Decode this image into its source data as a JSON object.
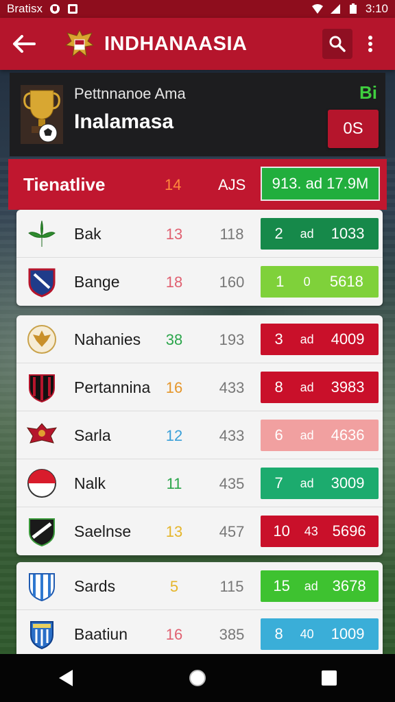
{
  "status_bar": {
    "carrier": "Bratisx",
    "time": "3:10"
  },
  "app_bar": {
    "title": "INDHANAASIA"
  },
  "header": {
    "subtitle": "Pettnnanoe Ama",
    "title": "Inalamasa",
    "badge": "Bi",
    "button_label": "0S"
  },
  "table": {
    "header": {
      "name": "Tienatlive",
      "played": "14",
      "goals": "AJS",
      "points": "913. ad 17.9M"
    },
    "rows": [
      {
        "name": "Bak",
        "played": "13",
        "played_color": "#e06070",
        "goals": "118",
        "pts": [
          "2",
          "ad",
          "1033"
        ],
        "color": "#16894a",
        "crest": "leaf-crest-icon"
      },
      {
        "name": "Bange",
        "played": "18",
        "played_color": "#e06070",
        "goals": "160",
        "pts": [
          "1",
          "0",
          "5618"
        ],
        "color": "#7fd13a",
        "crest": "shield-crest-icon"
      },
      {
        "name": "Nahanies",
        "played": "38",
        "played_color": "#2aa54a",
        "goals": "193",
        "pts": [
          "3",
          "ad",
          "4009"
        ],
        "color": "#c9102a",
        "crest": "garuda-crest-icon"
      },
      {
        "name": "Pertannina",
        "played": "16",
        "played_color": "#e5962a",
        "goals": "433",
        "pts": [
          "8",
          "ad",
          "3983"
        ],
        "color": "#c9102a",
        "crest": "striped-shield-icon"
      },
      {
        "name": "Sarla",
        "played": "12",
        "played_color": "#3aa0d8",
        "goals": "433",
        "pts": [
          "6",
          "ad",
          "4636"
        ],
        "color": "#f1a0a0",
        "crest": "eagle-crest-icon"
      },
      {
        "name": "Nalk",
        "played": "11",
        "played_color": "#2aa54a",
        "goals": "435",
        "pts": [
          "7",
          "ad",
          "3009"
        ],
        "color": "#1cab6e",
        "crest": "flag-crest-icon"
      },
      {
        "name": "Saelnse",
        "played": "13",
        "played_color": "#e5b52a",
        "goals": "457",
        "pts": [
          "10",
          "43",
          "5696"
        ],
        "color": "#c9102a",
        "crest": "black-shield-icon"
      },
      {
        "name": "Sards",
        "played": "5",
        "played_color": "#e5b52a",
        "goals": "115",
        "pts": [
          "15",
          "ad",
          "3678"
        ],
        "color": "#3ec230",
        "crest": "blue-stripe-shield-icon"
      },
      {
        "name": "Baatiun",
        "played": "16",
        "played_color": "#e06070",
        "goals": "385",
        "pts": [
          "8",
          "40",
          "1009"
        ],
        "color": "#3aaed8",
        "crest": "blue-castle-shield-icon"
      }
    ]
  }
}
